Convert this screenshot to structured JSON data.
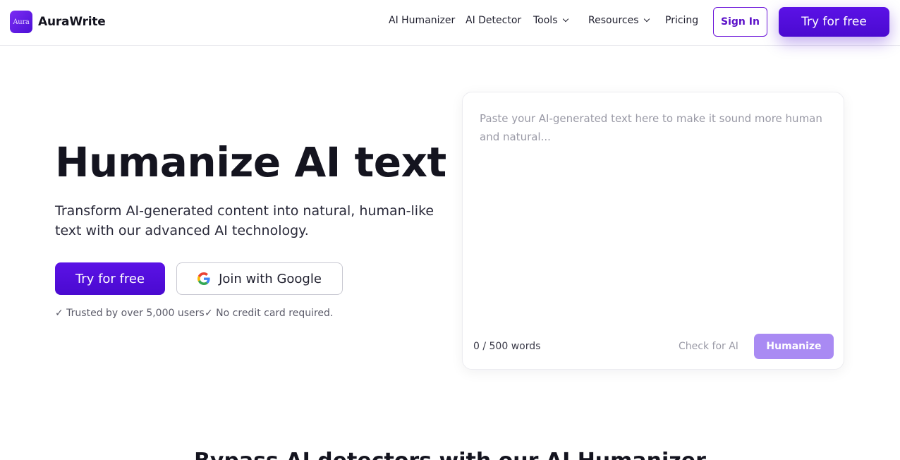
{
  "header": {
    "logo_text": "Aura",
    "brand": "AuraWrite",
    "nav": {
      "ai_humanizer": "AI Humanizer",
      "ai_detector": "AI Detector",
      "tools": "Tools",
      "resources": "Resources",
      "pricing": "Pricing"
    },
    "sign_in": "Sign In",
    "try_free": "Try for free"
  },
  "hero": {
    "title": "Humanize AI text",
    "subtitle": "Transform AI-generated content into natural, human-like text with our advanced AI technology.",
    "try_free": "Try for free",
    "google": "Join with Google",
    "trust_users": "✓ Trusted by over 5,000 users",
    "trust_card": "✓ No credit card required."
  },
  "editor": {
    "placeholder": "Paste your AI-generated text here to make it sound more human and natural...",
    "value": "",
    "word_count": "0 / 500 words",
    "check_ai": "Check for AI",
    "humanize": "Humanize"
  },
  "section": {
    "heading": "Bypass AI detectors with our AI Humanizer"
  },
  "colors": {
    "brand_purple": "#4a0ad0",
    "humanize_disabled": "#a98af3"
  },
  "icons": {
    "google": "google-icon",
    "dropdown": "chevron-down-icon"
  }
}
